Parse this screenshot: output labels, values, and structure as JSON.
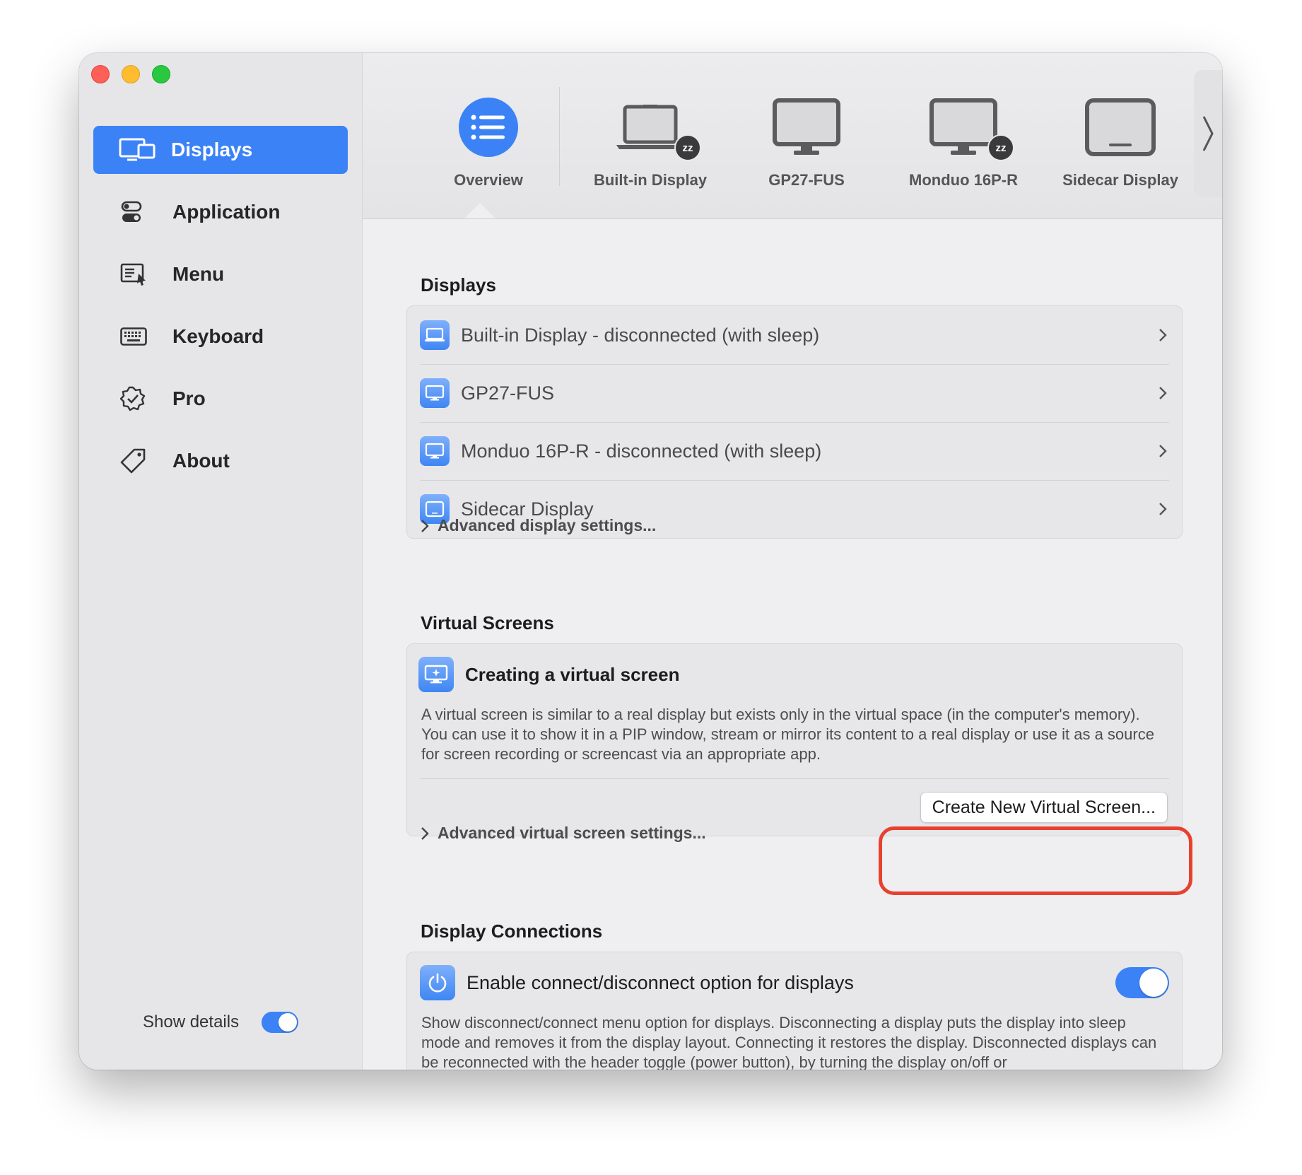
{
  "sidebar": {
    "items": [
      {
        "label": "Displays"
      },
      {
        "label": "Application"
      },
      {
        "label": "Menu"
      },
      {
        "label": "Keyboard"
      },
      {
        "label": "Pro"
      },
      {
        "label": "About"
      }
    ],
    "show_details_label": "Show details",
    "show_details_on": true
  },
  "tabs": [
    {
      "label": "Overview",
      "icon": "list-icon"
    },
    {
      "label": "Built-in Display",
      "icon": "laptop-icon",
      "badge": "zz"
    },
    {
      "label": "GP27-FUS",
      "icon": "monitor-icon"
    },
    {
      "label": "Monduo 16P-R",
      "icon": "monitor-icon",
      "badge": "zz"
    },
    {
      "label": "Sidecar Display",
      "icon": "tablet-icon"
    }
  ],
  "displays": {
    "title": "Displays",
    "rows": [
      {
        "label": "Built-in Display - disconnected (with sleep)"
      },
      {
        "label": "GP27-FUS"
      },
      {
        "label": "Monduo 16P-R - disconnected (with sleep)"
      },
      {
        "label": "Sidecar Display"
      }
    ],
    "advanced_label": "Advanced display settings..."
  },
  "virtual_screens": {
    "title": "Virtual Screens",
    "card_title": "Creating a virtual screen",
    "description": "A virtual screen is similar to a real display but exists only in the virtual space (in the computer's memory). You can use it to show it in a PIP window, stream or mirror its content to a real display or use it as a source for screen recording or screencast via an appropriate app.",
    "button_label": "Create New Virtual Screen...",
    "advanced_label": "Advanced virtual screen settings..."
  },
  "display_connections": {
    "title": "Display Connections",
    "option_label": "Enable connect/disconnect option for displays",
    "option_on": true,
    "description": "Show disconnect/connect menu option for displays. Disconnecting a display puts the display into sleep mode and removes it from the display layout. Connecting it restores the display. Disconnected displays can be reconnected with the header toggle (power button), by turning the display on/off or"
  },
  "colors": {
    "accent": "#3b82f6",
    "highlight": "#e8412f"
  }
}
